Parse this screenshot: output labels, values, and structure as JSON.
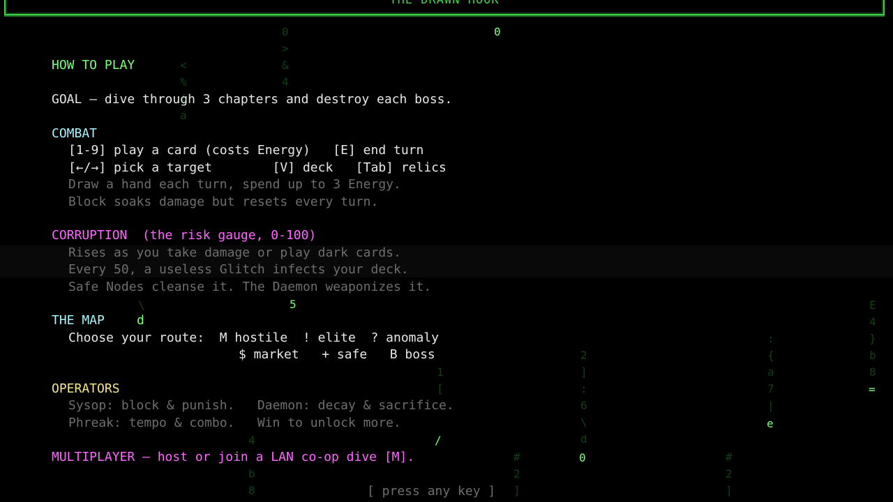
{
  "title": "THE DRAWN HOOK",
  "how_to_play": "HOW TO PLAY",
  "goal": "GOAL — dive through 3 chapters and destroy each boss.",
  "combat": {
    "heading": "COMBAT",
    "line1": "[1-9] play a card (costs Energy)   [E] end turn",
    "line2": "[←/→] pick a target        [V] deck   [Tab] relics",
    "note1": "Draw a hand each turn, spend up to 3 Energy.",
    "note2": "Block soaks damage but resets every turn."
  },
  "corruption": {
    "heading": "CORRUPTION  (the risk gauge, 0-100)",
    "line1": "Rises as you take damage or play dark cards.",
    "line2": "Every 50, a useless Glitch infects your deck.",
    "line3": "Safe Nodes cleanse it. The Daemon weaponizes it."
  },
  "map": {
    "heading": "THE MAP",
    "line1": "Choose your route:  M hostile  ! elite  ? anomaly",
    "line2": "$ market   + safe   B boss"
  },
  "operators": {
    "heading": "OPERATORS",
    "line1": "Sysop: block & punish.   Daemon: decay & sacrifice.",
    "line2": "Phreak: tempo & combo.   Win to unlock more."
  },
  "multiplayer": "MULTIPLAYER — host or join a LAN co-op dive [M].",
  "prompt": "[ press any key ]",
  "rain_chars": {
    "top_zero": "0",
    "five": "5",
    "d": "d",
    "equals": "=",
    "e": "e",
    "slash": "/",
    "zero_right": "0"
  },
  "colors": {
    "accent_green": "#3fcf4b",
    "heading_green": "#7dff7f",
    "heading_cyan": "#a8f4ff",
    "heading_magenta": "#ff66ff",
    "heading_yellow": "#f5e68a",
    "dim_text": "#6e6e6e"
  }
}
